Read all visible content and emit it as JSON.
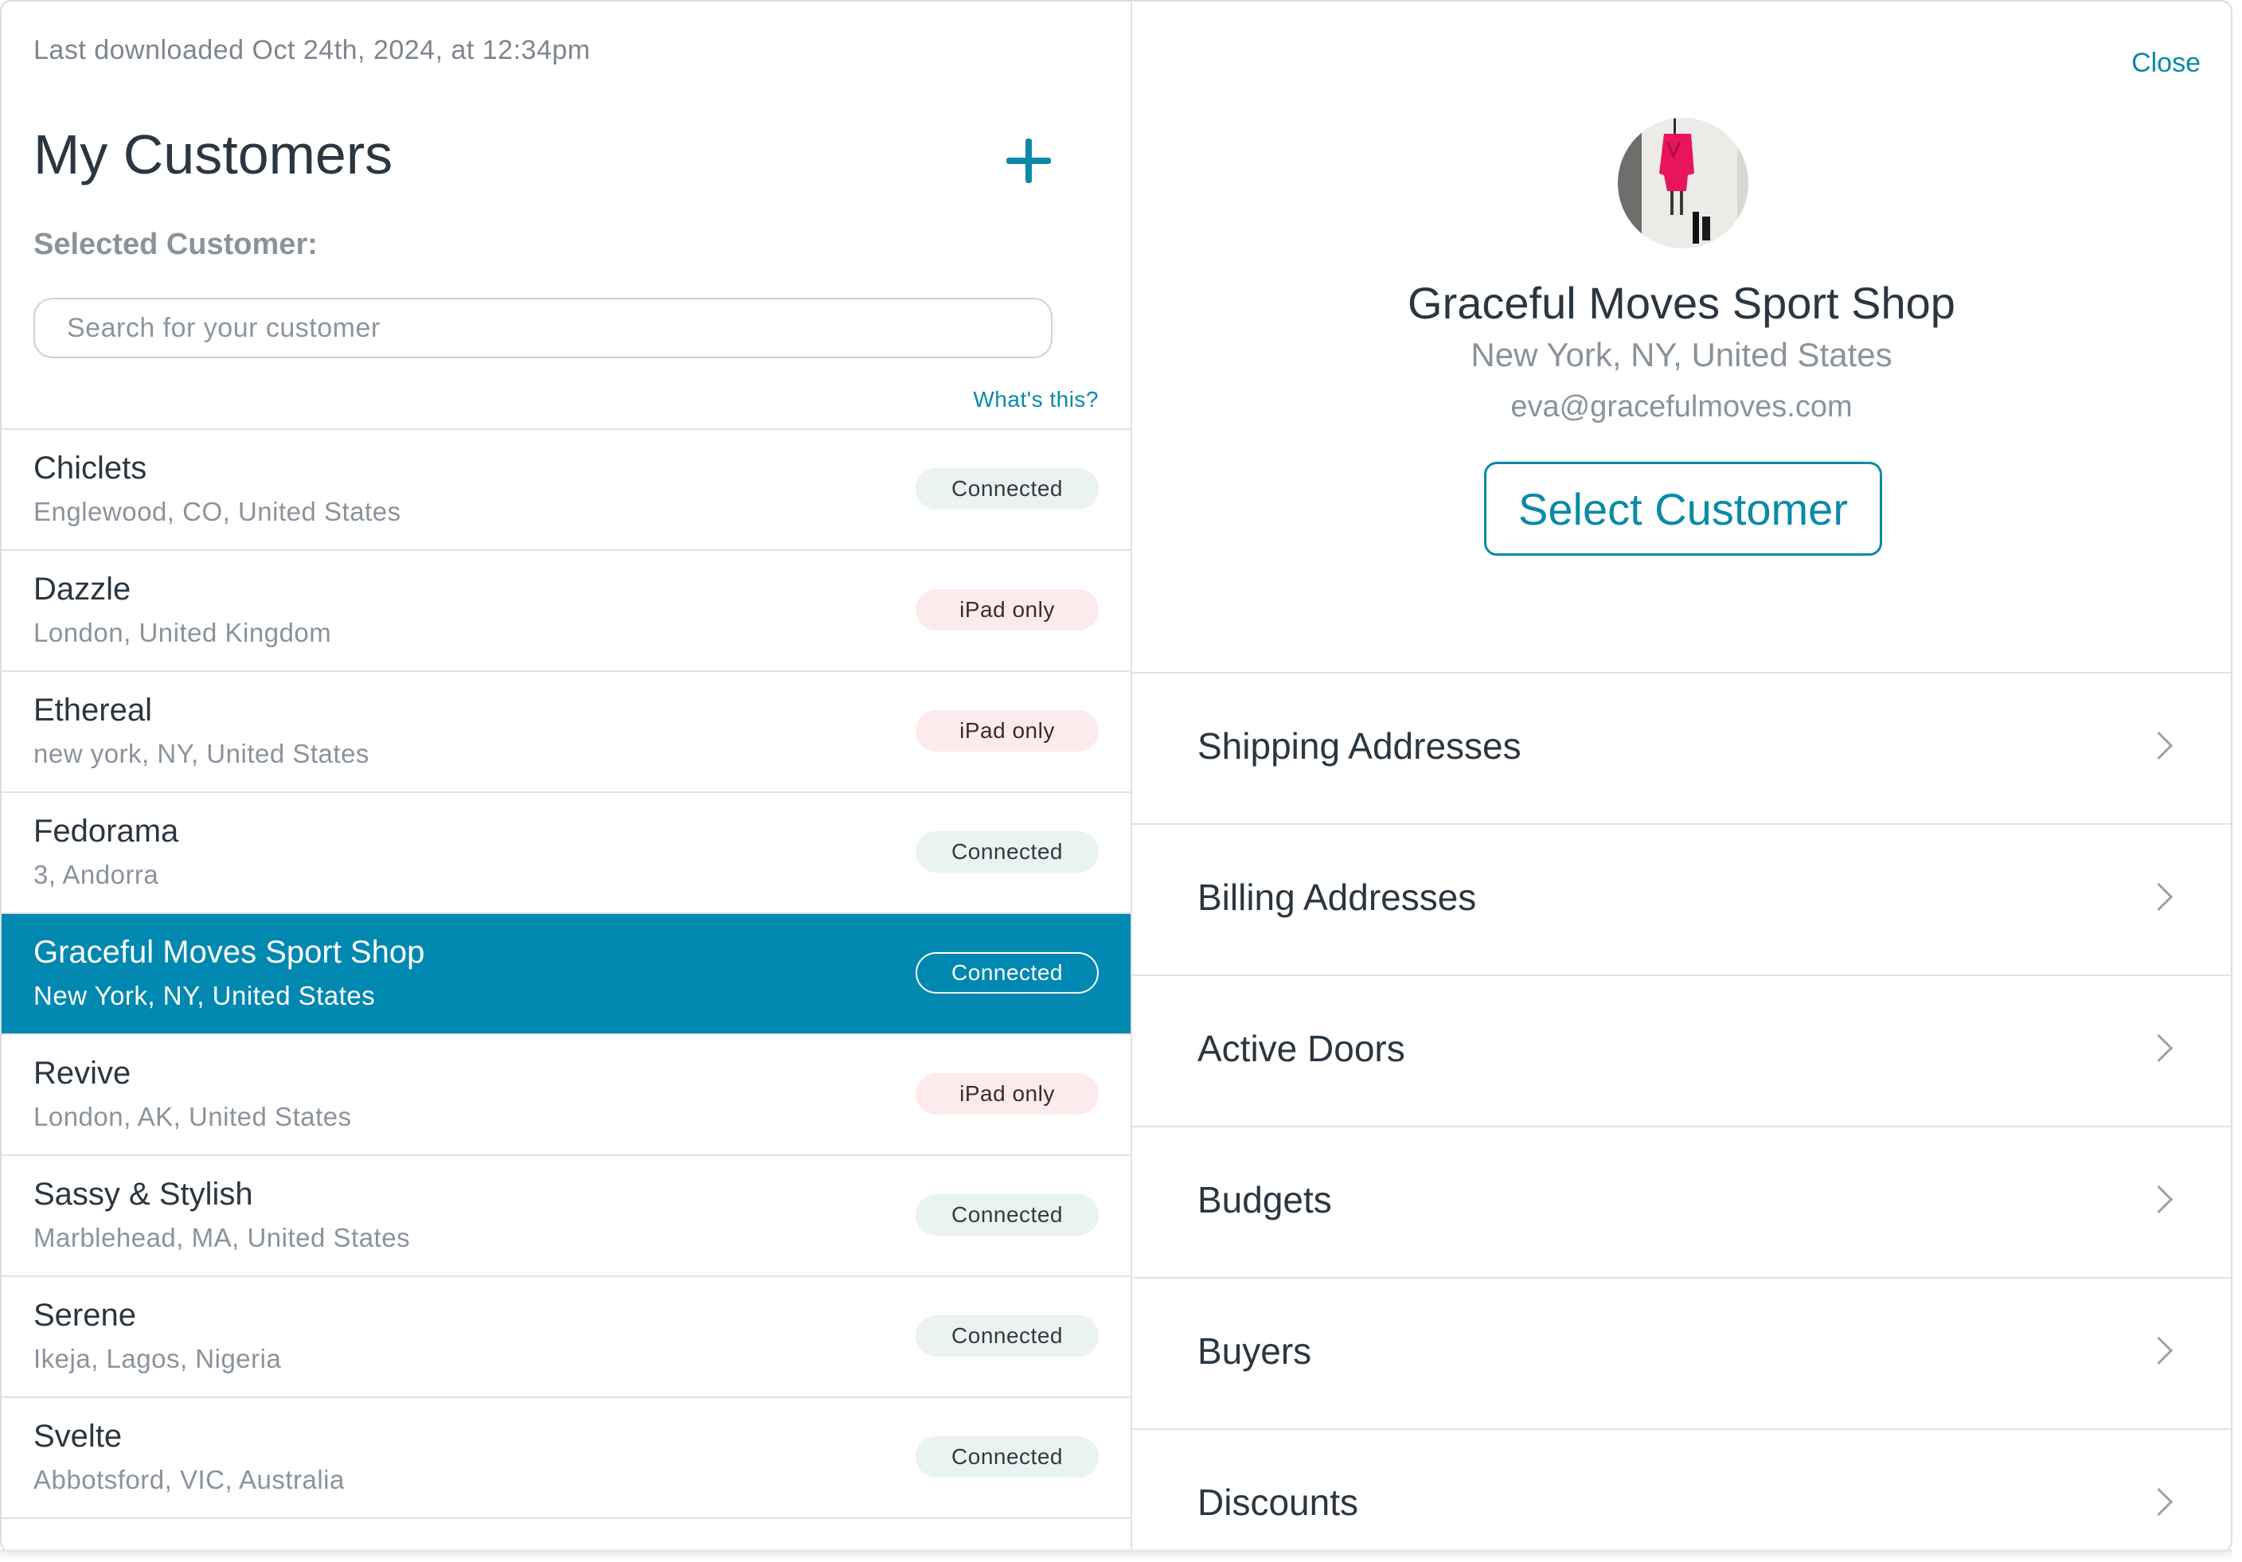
{
  "header": {
    "last_downloaded": "Last downloaded Oct 24th, 2024, at 12:34pm",
    "title": "My Customers",
    "selected_label": "Selected Customer:",
    "whats_this": "What's this?"
  },
  "search": {
    "placeholder": "Search for your customer",
    "value": ""
  },
  "customers": [
    {
      "name": "Chiclets",
      "location": "Englewood, CO, United States",
      "status": "Connected",
      "selected": false
    },
    {
      "name": "Dazzle",
      "location": "London, United Kingdom",
      "status": "iPad only",
      "selected": false
    },
    {
      "name": "Ethereal",
      "location": "new york, NY, United States",
      "status": "iPad only",
      "selected": false
    },
    {
      "name": "Fedorama",
      "location": "3, Andorra",
      "status": "Connected",
      "selected": false
    },
    {
      "name": "Graceful Moves Sport Shop",
      "location": "New York, NY, United States",
      "status": "Connected",
      "selected": true
    },
    {
      "name": "Revive",
      "location": "London, AK, United States",
      "status": "iPad only",
      "selected": false
    },
    {
      "name": "Sassy & Stylish",
      "location": "Marblehead, MA, United States",
      "status": "Connected",
      "selected": false
    },
    {
      "name": "Serene",
      "location": "Ikeja, Lagos, Nigeria",
      "status": "Connected",
      "selected": false
    },
    {
      "name": "Svelte",
      "location": "Abbotsford, VIC, Australia",
      "status": "Connected",
      "selected": false
    }
  ],
  "detail": {
    "close_label": "Close",
    "name": "Graceful Moves Sport Shop",
    "location": "New York, NY, United States",
    "email": "eva@gracefulmoves.com",
    "select_button": "Select Customer",
    "menu": [
      {
        "label": "Shipping Addresses"
      },
      {
        "label": "Billing Addresses"
      },
      {
        "label": "Active Doors"
      },
      {
        "label": "Budgets"
      },
      {
        "label": "Buyers"
      },
      {
        "label": "Discounts"
      }
    ]
  },
  "colors": {
    "accent": "#0a8aa8",
    "selected_row": "#0088b0",
    "connected_badge": "#eaf3ef",
    "ipad_badge": "#fdeaec"
  },
  "icons": {
    "add": "plus-icon",
    "menu_chevron": "chevron-right-icon"
  }
}
